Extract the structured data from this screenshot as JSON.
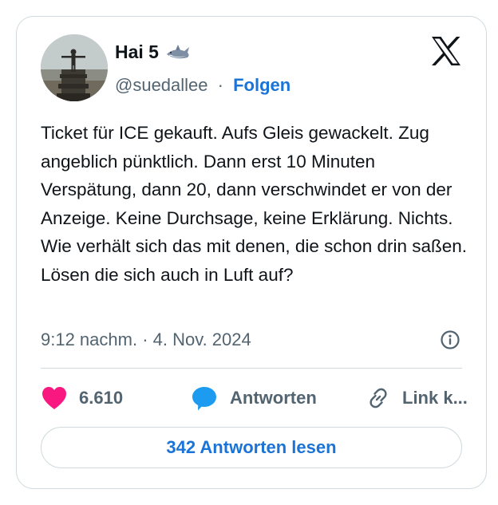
{
  "author": {
    "name": "Hai 5",
    "handle": "@suedallee",
    "separator": "·",
    "follow_label": "Folgen"
  },
  "tweet": {
    "text": "Ticket für ICE gekauft. Aufs Gleis gewackelt. Zug angeblich pünktlich. Dann erst 10 Minuten Verspätung, dann 20, dann verschwindet er von der Anzeige. Keine Durchsage, keine Erklärung. Nichts. Wie verhält sich das mit denen, die schon drin saßen. Lösen die sich auch in Luft auf?",
    "timestamp": "9:12 nachm. · 4. Nov. 2024"
  },
  "actions": {
    "like_count": "6.610",
    "reply_label": "Antworten",
    "link_label": "Link k..."
  },
  "read_replies_label": "342 Antworten lesen",
  "colors": {
    "accent": "#1a73d6",
    "like": "#f91880",
    "reply": "#1d9bf0",
    "muted": "#536471",
    "border": "#cfd9de",
    "text": "#0f1419"
  },
  "icons": {
    "platform": "x-logo-icon",
    "name_emoji": "shark-icon",
    "info": "info-icon",
    "like": "heart-icon",
    "reply": "speech-bubble-icon",
    "link": "link-icon"
  }
}
